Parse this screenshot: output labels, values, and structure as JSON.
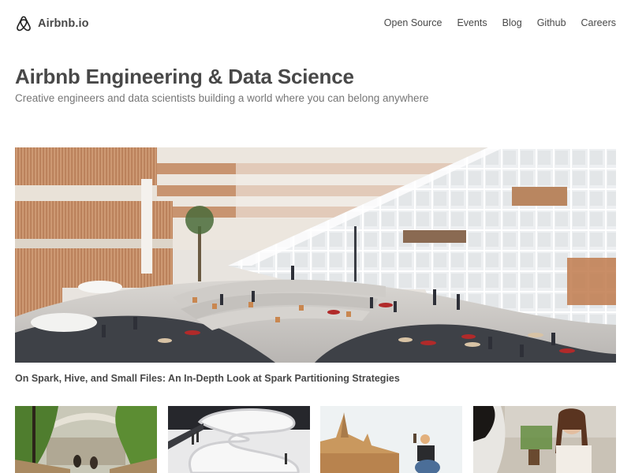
{
  "header": {
    "logo_text": "Airbnb.io",
    "logo_icon": "airbnb-belo-icon",
    "nav": [
      {
        "label": "Open Source"
      },
      {
        "label": "Events"
      },
      {
        "label": "Blog"
      },
      {
        "label": "Github"
      },
      {
        "label": "Careers"
      }
    ]
  },
  "hero": {
    "title": "Airbnb Engineering & Data Science",
    "subtitle": "Creative engineers and data scientists building a world where you can belong anywhere",
    "featured_image_alt": "Atrium of Airbnb office with wooden balconies, glass staircase and seating areas",
    "featured_caption": "On Spark, Hive, and Small Files: An In-Depth Look at Spark Partitioning Strategies"
  },
  "thumbnails": [
    {
      "alt": "People on a wooden bridge among trees by a river"
    },
    {
      "alt": "Spiral white staircase in modern building interior"
    },
    {
      "alt": "Woman taking a photo with a phone in front of temple riverside"
    },
    {
      "alt": "Two women talking at a table with plants"
    }
  ]
}
